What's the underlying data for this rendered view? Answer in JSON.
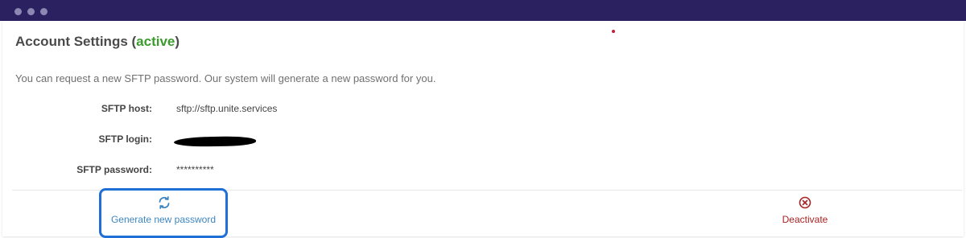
{
  "window": {
    "controls": [
      "dot",
      "dot",
      "dot"
    ]
  },
  "account": {
    "title": "Account Settings (",
    "status": "active",
    "title_close": ")",
    "description": "You can request a new SFTP password. Our system will generate a new password for you."
  },
  "fields": {
    "host_label": "SFTP host:",
    "host_value": "sftp://sftp.unite.services",
    "login_label": "SFTP login:",
    "login_value": "",
    "password_label": "SFTP password:",
    "password_value": "**********"
  },
  "actions": {
    "generate_label": "Generate new password",
    "generate_icon": "refresh-icon",
    "deactivate_label": "Deactivate",
    "deactivate_icon": "circle-x-icon"
  },
  "colors": {
    "titlebar": "#2b2161",
    "status_active": "#3c9a2e",
    "link_blue": "#3d86bf",
    "highlight_border": "#1f6fd6",
    "danger": "#a82222"
  }
}
